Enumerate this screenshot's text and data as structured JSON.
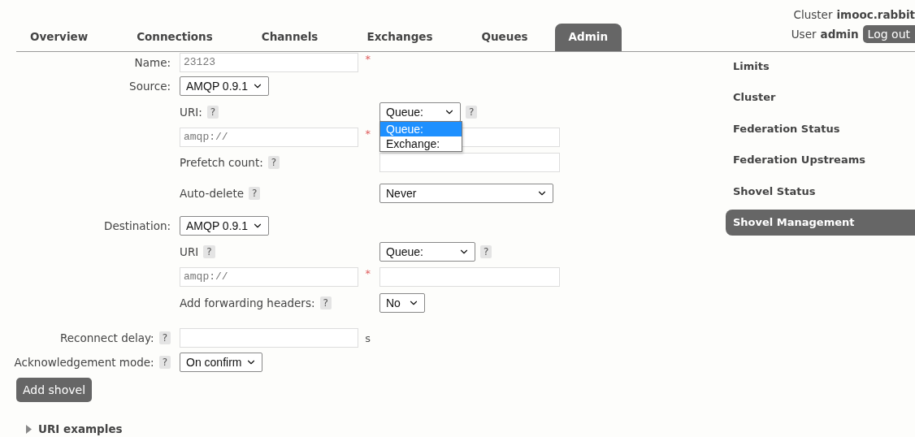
{
  "header": {
    "cluster_label": "Cluster",
    "cluster": "imooc.rabbit",
    "user_label": "User",
    "user": "admin",
    "logout": "Log out"
  },
  "tabs": [
    {
      "label": "Overview",
      "selected": false
    },
    {
      "label": "Connections",
      "selected": false
    },
    {
      "label": "Channels",
      "selected": false
    },
    {
      "label": "Exchanges",
      "selected": false
    },
    {
      "label": "Queues",
      "selected": false
    },
    {
      "label": "Admin",
      "selected": true
    }
  ],
  "sidebar": {
    "items": [
      {
        "label": "Limits",
        "selected": false
      },
      {
        "label": "Cluster",
        "selected": false
      },
      {
        "label": "Federation Status",
        "selected": false
      },
      {
        "label": "Federation Upstreams",
        "selected": false
      },
      {
        "label": "Shovel Status",
        "selected": false
      },
      {
        "label": "Shovel Management",
        "selected": true
      }
    ]
  },
  "form": {
    "name": {
      "label": "Name:",
      "value": "23123",
      "required_mark": "*"
    },
    "source": {
      "label": "Source:",
      "protocol": "AMQP 0.9.1",
      "uri_label": "URI:",
      "uri_help": "?",
      "type_select": "Queue:",
      "type_help": "?",
      "dropdown": {
        "open": true,
        "options": [
          {
            "label": "Queue:",
            "selected": true
          },
          {
            "label": "Exchange:",
            "selected": false
          }
        ]
      },
      "uri_value": "amqp://",
      "required_mark": "*",
      "prefetch_label": "Prefetch count:",
      "prefetch_help": "?",
      "autodelete_label": "Auto-delete",
      "autodelete_help": "?",
      "autodelete_value": "Never"
    },
    "destination": {
      "label": "Destination:",
      "protocol": "AMQP 0.9.1",
      "uri_label": "URI",
      "uri_help": "?",
      "type_select": "Queue:",
      "type_help": "?",
      "uri_value": "amqp://",
      "required_mark": "*",
      "headers_label": "Add forwarding headers:",
      "headers_help": "?",
      "headers_value": "No"
    },
    "reconnect": {
      "label": "Reconnect delay:",
      "help": "?",
      "unit": "s"
    },
    "ack": {
      "label": "Acknowledgement mode:",
      "help": "?",
      "value": "On confirm"
    },
    "submit": "Add shovel"
  },
  "uri_examples": {
    "label": "URI examples",
    "expanded": false
  }
}
